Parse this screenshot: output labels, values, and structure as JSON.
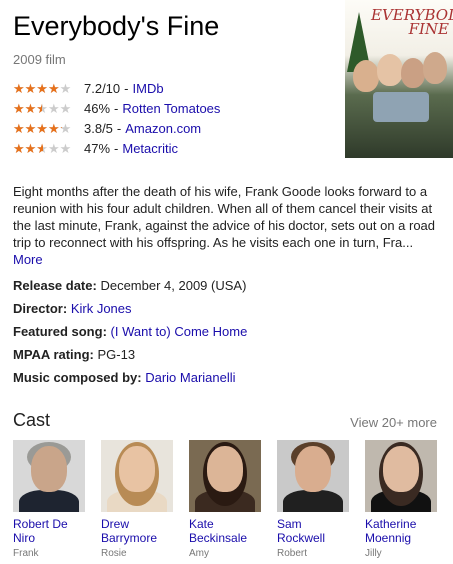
{
  "header": {
    "title": "Everybody's Fine",
    "subtitle": "2009 film"
  },
  "poster": {
    "line1": "EVERYBODY'S",
    "line2": "FINE"
  },
  "ratings": [
    {
      "score": "7.2/10",
      "source": "IMDb",
      "fill": 0.72
    },
    {
      "score": "46%",
      "source": "Rotten Tomatoes",
      "fill": 0.46
    },
    {
      "score": "3.8/5",
      "source": "Amazon.com",
      "fill": 0.76
    },
    {
      "score": "47%",
      "source": "Metacritic",
      "fill": 0.47
    }
  ],
  "description": {
    "text": "Eight months after the death of his wife, Frank Goode looks forward to a reunion with his four adult children. When all of them cancel their visits at the last minute, Frank, against the advice of his doctor, sets out on a road trip to reconnect with his offspring. As he visits each one in turn, Fra...",
    "more_label": "More"
  },
  "facts": [
    {
      "label": "Release date:",
      "value": "December 4, 2009 (USA)",
      "link": false
    },
    {
      "label": "Director:",
      "value": "Kirk Jones",
      "link": true
    },
    {
      "label": "Featured song:",
      "value": "(I Want to) Come Home",
      "link": true
    },
    {
      "label": "MPAA rating:",
      "value": "PG-13",
      "link": false
    },
    {
      "label": "Music composed by:",
      "value": "Dario Marianelli",
      "link": true
    }
  ],
  "cast": {
    "heading": "Cast",
    "more_label": "View 20+ more",
    "members": [
      {
        "name": "Robert De Niro",
        "role": "Frank",
        "skin": "#c9a58a",
        "hair": "#9a9a96",
        "shirt": "#1e2430",
        "bg": "#d8d8d8"
      },
      {
        "name": "Drew Barrymore",
        "role": "Rosie",
        "skin": "#e8c3a3",
        "hair": "#b88b55",
        "shirt": "#e9d9c4",
        "bg": "#e8e4dc"
      },
      {
        "name": "Kate Beckinsale",
        "role": "Amy",
        "skin": "#dcb597",
        "hair": "#2a1a12",
        "shirt": "#3b2a20",
        "bg": "#7a6a52"
      },
      {
        "name": "Sam Rockwell",
        "role": "Robert",
        "skin": "#d9ad8f",
        "hair": "#5a3f2a",
        "shirt": "#202020",
        "bg": "#c9c9c9"
      },
      {
        "name": "Katherine Moennig",
        "role": "Jilly",
        "skin": "#e0bba0",
        "hair": "#3a2a22",
        "shirt": "#111",
        "bg": "#bfb8ae"
      }
    ]
  }
}
